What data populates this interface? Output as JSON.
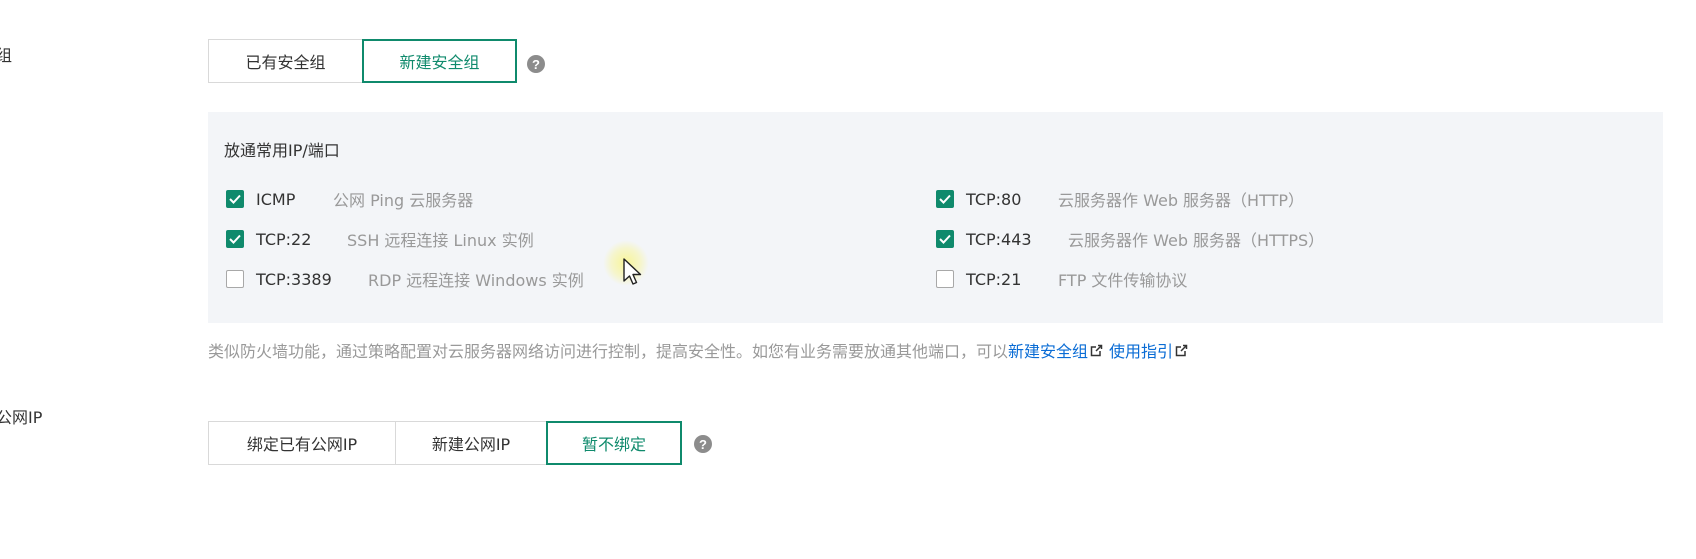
{
  "labels": {
    "security_group": "组",
    "public_ip": "公网IP"
  },
  "security_group": {
    "options": [
      "已有安全组",
      "新建安全组"
    ],
    "help": "?"
  },
  "panel": {
    "title": "放通常用IP/端口",
    "rules": [
      {
        "port": "ICMP",
        "desc": "公网 Ping 云服务器",
        "checked": true
      },
      {
        "port": "TCP:80",
        "desc": "云服务器作 Web 服务器（HTTP）",
        "checked": true
      },
      {
        "port": "TCP:22",
        "desc": "SSH 远程连接 Linux 实例",
        "checked": true
      },
      {
        "port": "TCP:443",
        "desc": "云服务器作 Web 服务器（HTTPS）",
        "checked": true
      },
      {
        "port": "TCP:3389",
        "desc": "RDP 远程连接 Windows 实例",
        "checked": false
      },
      {
        "port": "TCP:21",
        "desc": "FTP 文件传输协议",
        "checked": false
      }
    ]
  },
  "hint": {
    "text": "类似防火墙功能，通过策略配置对云服务器网络访问进行控制，提高安全性。如您有业务需要放通其他端口，可以",
    "link1": "新建安全组",
    "link2": "使用指引"
  },
  "public_ip": {
    "options": [
      "绑定已有公网IP",
      "新建公网IP",
      "暂不绑定"
    ],
    "help": "?"
  },
  "colors": {
    "accent": "#0f8a6c",
    "link": "#0a6cd5",
    "panel_bg": "#f3f5f8",
    "muted": "#999999"
  }
}
